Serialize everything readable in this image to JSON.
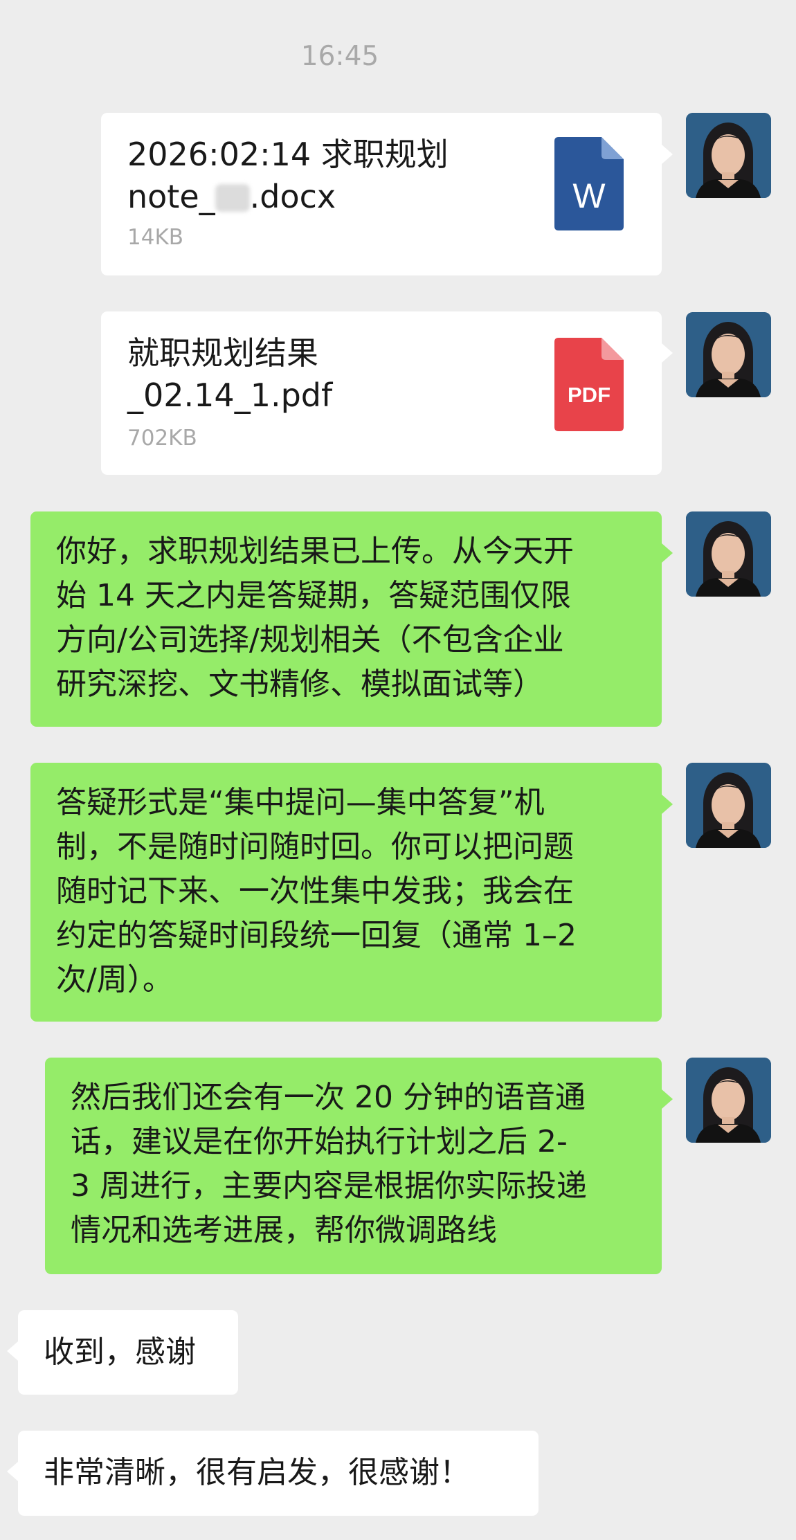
{
  "timestamp": "16:45",
  "messages": [
    {
      "type": "file",
      "name_line1": "2026:02:14 求职规划",
      "name_line2_prefix": " note_",
      "name_line2_suffix": ".docx",
      "size": "14KB",
      "icon": "word-file-icon",
      "icon_label": "W",
      "icon_color": "#2b579a"
    },
    {
      "type": "file",
      "name_line1": "就职规划结果",
      "name_line2": "_02.14_1.pdf",
      "size": "702KB",
      "icon": "pdf-file-icon",
      "icon_label": "PDF",
      "icon_color": "#e8434a"
    },
    {
      "type": "text",
      "text": "你好，求职规划结果已上传。从今天开\n始 14 天之内是答疑期，答疑范围仅限\n方向/公司选择/规划相关（不包含企业\n研究深挖、文书精修、模拟面试等）"
    },
    {
      "type": "text",
      "text": "答疑形式是“集中提问—集中答复”机\n制，不是随时问随时回。你可以把问题\n随时记下来、一次性集中发我；我会在\n约定的答疑时间段统一回复（通常 1–2\n次/周）。"
    },
    {
      "type": "text",
      "text": "然后我们还会有一次 20 分钟的语音通\n话，建议是在你开始执行计划之后 2-\n3 周进行，主要内容是根据你实际投递\n情况和选考进展，帮你微调路线"
    },
    {
      "type": "text",
      "text": "收到，感谢"
    },
    {
      "type": "text",
      "text": "非常清晰，很有启发，很感谢！"
    }
  ],
  "colors": {
    "background": "#ededed",
    "sent_bubble": "#95ec69",
    "received_bubble": "#ffffff",
    "timestamp": "#a9a9a9",
    "file_size": "#a8a8a8"
  }
}
